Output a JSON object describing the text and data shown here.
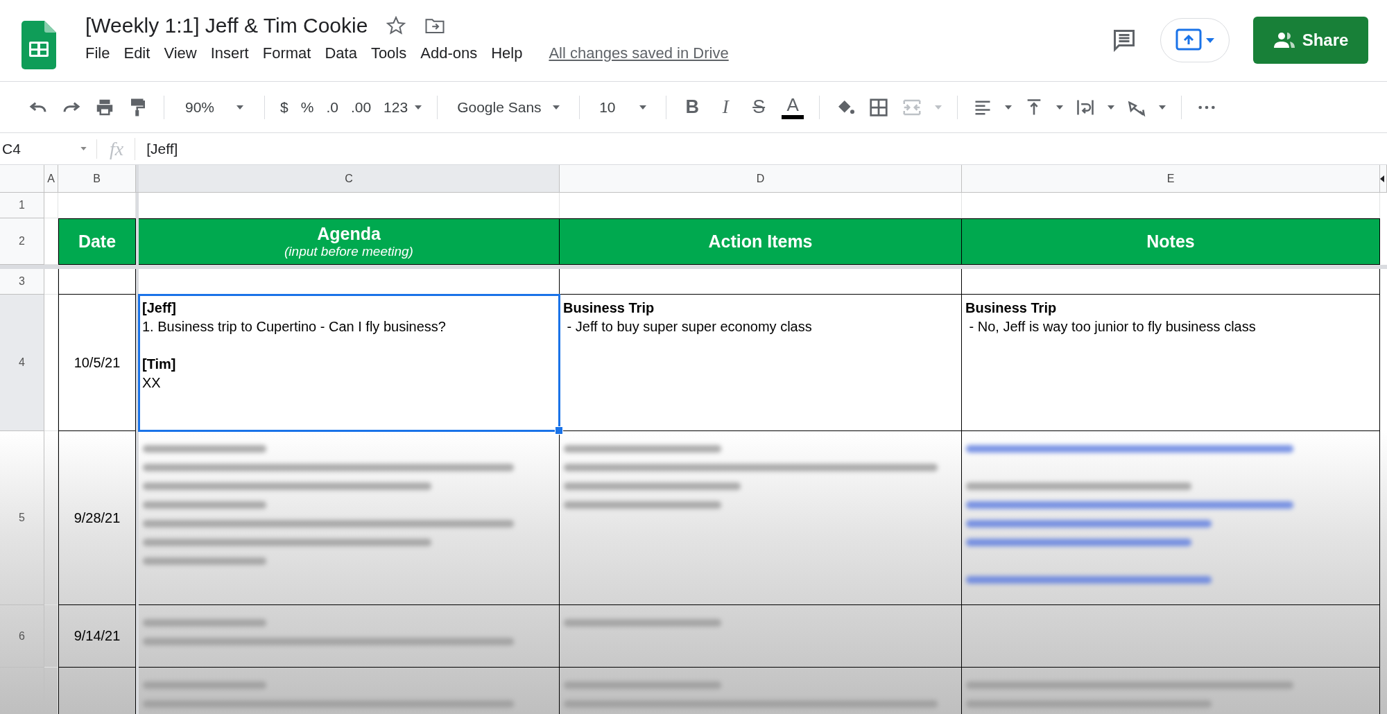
{
  "document": {
    "title": "[Weekly 1:1] Jeff & Tim Cookie",
    "save_status": "All changes saved in Drive"
  },
  "menu": [
    "File",
    "Edit",
    "View",
    "Insert",
    "Format",
    "Data",
    "Tools",
    "Add-ons",
    "Help"
  ],
  "share_button": "Share",
  "toolbar": {
    "zoom": "90%",
    "currency": "$",
    "percent": "%",
    "decrease_decimals": ".0",
    "increase_decimals": ".00",
    "more_formats": "123",
    "font": "Google Sans",
    "font_size": "10",
    "bold": "B",
    "italic": "I",
    "strikethrough": "S",
    "text_color": "A"
  },
  "formula_bar": {
    "cell_ref": "C4",
    "fx": "fx",
    "value": "[Jeff]"
  },
  "column_headers": [
    {
      "label": "A",
      "selected": false
    },
    {
      "label": "B",
      "selected": false
    },
    {
      "label": "C",
      "selected": true
    },
    {
      "label": "D",
      "selected": false
    },
    {
      "label": "E",
      "selected": false
    }
  ],
  "rows": [
    {
      "number": "1",
      "selected": false,
      "kind": "blank"
    },
    {
      "number": "2",
      "selected": false,
      "kind": "header",
      "cells": [
        {
          "kind": "title",
          "title": "Date"
        },
        {
          "kind": "title",
          "title": "Agenda",
          "subtitle": "(input before meeting)"
        },
        {
          "kind": "title",
          "title": "Action Items"
        },
        {
          "kind": "title",
          "title": "Notes"
        }
      ]
    },
    {
      "number": "3",
      "selected": false,
      "kind": "spacer"
    },
    {
      "number": "4",
      "selected": true,
      "kind": "entry",
      "cells": [
        {
          "kind": "date",
          "text": "10/5/21"
        },
        {
          "kind": "notes",
          "selected": true,
          "blocks": [
            {
              "heading": "[Jeff]",
              "lines": [
                "1. Business trip to Cupertino - Can I fly business?"
              ]
            },
            {
              "heading": "[Tim]",
              "lines": [
                "XX"
              ]
            }
          ]
        },
        {
          "kind": "notes",
          "selected": false,
          "blocks": [
            {
              "heading": "Business Trip",
              "lines": [
                " - Jeff to buy super super economy class"
              ]
            }
          ]
        },
        {
          "kind": "notes",
          "selected": false,
          "blocks": [
            {
              "heading": "Business Trip",
              "lines": [
                " - No, Jeff is way too junior to fly business class"
              ]
            }
          ]
        }
      ]
    },
    {
      "number": "5",
      "selected": false,
      "kind": "entry",
      "cells": [
        {
          "kind": "date",
          "text": "9/28/21"
        },
        {
          "kind": "blurred"
        },
        {
          "kind": "blurred"
        },
        {
          "kind": "blurred"
        }
      ]
    },
    {
      "number": "6",
      "selected": false,
      "kind": "entry",
      "cells": [
        {
          "kind": "date",
          "text": "9/14/21"
        },
        {
          "kind": "blurred"
        },
        {
          "kind": "blurred"
        },
        {
          "kind": "empty"
        }
      ]
    },
    {
      "selected": false,
      "kind": "entry",
      "cells": [
        {
          "kind": "date"
        },
        {
          "kind": "blurred"
        },
        {
          "kind": "blurred"
        },
        {
          "kind": "blurred"
        }
      ]
    }
  ]
}
